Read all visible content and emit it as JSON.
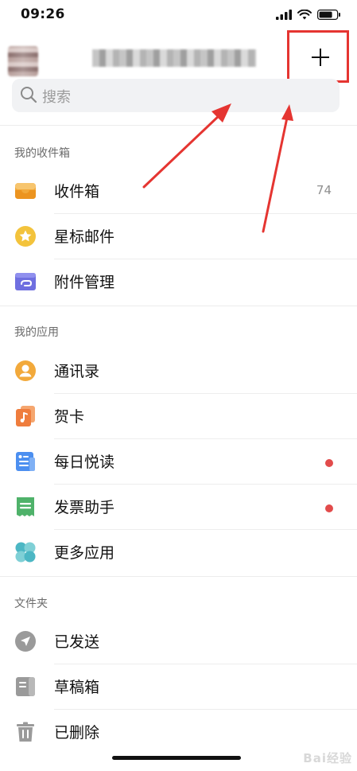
{
  "status": {
    "time": "09:26"
  },
  "header": {
    "add_label": "+"
  },
  "search": {
    "placeholder": "搜索"
  },
  "sections": {
    "mailbox": {
      "title": "我的收件箱",
      "items": [
        {
          "label": "收件箱",
          "count": "74",
          "icon": "inbox-icon",
          "color": "#f2a93b"
        },
        {
          "label": "星标邮件",
          "icon": "star-icon",
          "color": "#f3c33c"
        },
        {
          "label": "附件管理",
          "icon": "attachment-icon",
          "color": "#6f6fe0"
        }
      ]
    },
    "apps": {
      "title": "我的应用",
      "items": [
        {
          "label": "通讯录",
          "icon": "contacts-icon",
          "color": "#f2a93b"
        },
        {
          "label": "贺卡",
          "icon": "greeting-card-icon",
          "color": "#ef7d3d"
        },
        {
          "label": "每日悦读",
          "icon": "reading-icon",
          "color": "#4c8ff0",
          "badge": true
        },
        {
          "label": "发票助手",
          "icon": "invoice-icon",
          "color": "#4fb26a",
          "badge": true
        },
        {
          "label": "更多应用",
          "icon": "more-apps-icon",
          "color": "#4cb7c4"
        }
      ]
    },
    "folders": {
      "title": "文件夹",
      "items": [
        {
          "label": "已发送",
          "icon": "sent-icon",
          "color": "#9a9a9a"
        },
        {
          "label": "草稿箱",
          "icon": "drafts-icon",
          "color": "#9a9a9a"
        },
        {
          "label": "已删除",
          "icon": "trash-icon",
          "color": "#9a9a9a"
        }
      ]
    }
  },
  "watermark": "Bai经验",
  "colors": {
    "annotation_red": "#e53531",
    "badge_red": "#e24b4b"
  }
}
